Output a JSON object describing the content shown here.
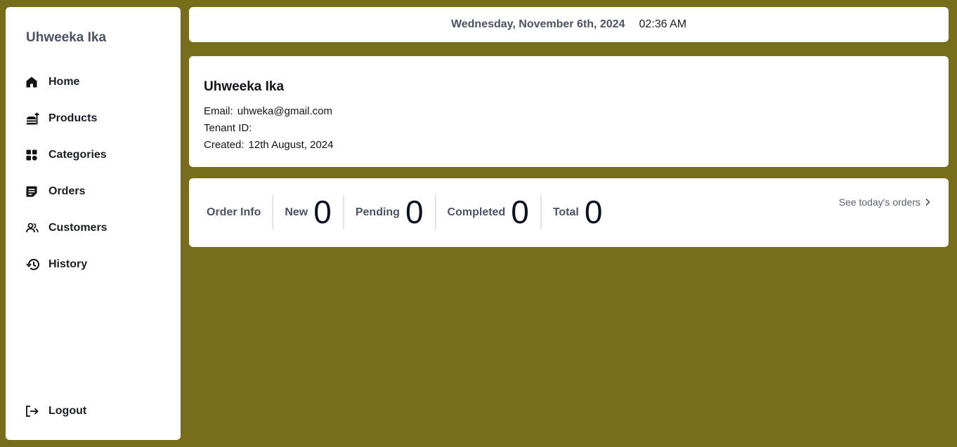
{
  "sidebar": {
    "brand": "Uhweeka Ika",
    "items": [
      {
        "label": "Home",
        "icon": "home-icon"
      },
      {
        "label": "Products",
        "icon": "products-icon"
      },
      {
        "label": "Categories",
        "icon": "categories-icon"
      },
      {
        "label": "Orders",
        "icon": "orders-icon"
      },
      {
        "label": "Customers",
        "icon": "customers-icon"
      },
      {
        "label": "History",
        "icon": "history-icon"
      }
    ],
    "logout": {
      "label": "Logout",
      "icon": "logout-icon"
    }
  },
  "header": {
    "date": "Wednesday, November 6th, 2024",
    "time": "02:36 AM"
  },
  "profile": {
    "name": "Uhweeka Ika",
    "email_label": "Email:",
    "email": "uhweka@gmail.com",
    "tenant_label": "Tenant ID:",
    "tenant_id": "",
    "created_label": "Created:",
    "created": "12th August, 2024"
  },
  "order_info": {
    "title": "Order Info",
    "stats": [
      {
        "label": "New",
        "value": "0"
      },
      {
        "label": "Pending",
        "value": "0"
      },
      {
        "label": "Completed",
        "value": "0"
      },
      {
        "label": "Total",
        "value": "0"
      }
    ],
    "see_today_label": "See today's orders"
  },
  "colors": {
    "background": "#776d1c",
    "card": "#ffffff",
    "muted_text": "#4b5261"
  }
}
